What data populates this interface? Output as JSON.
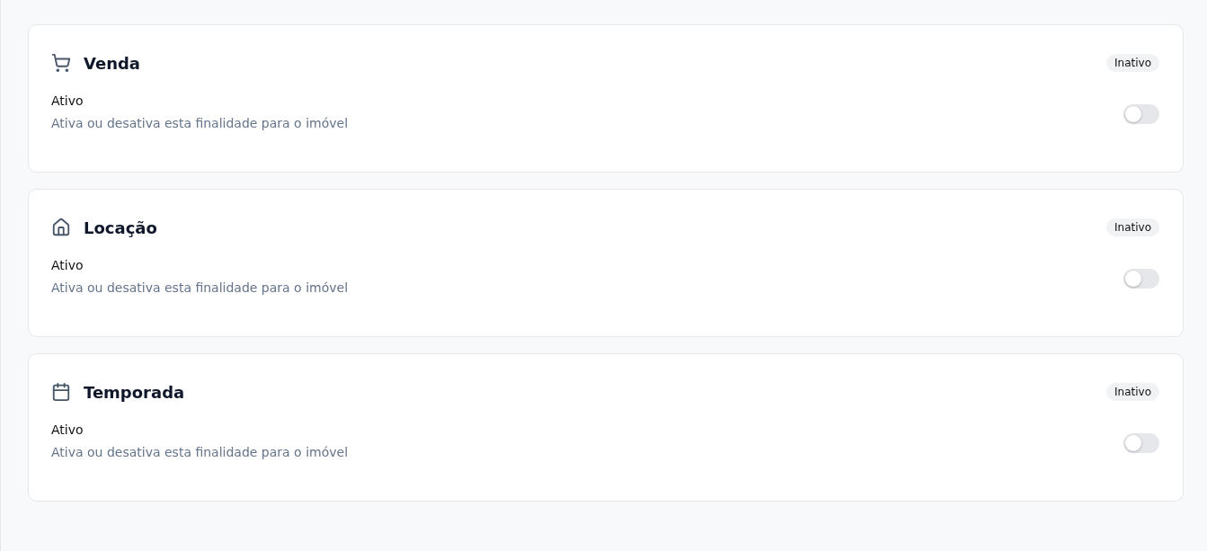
{
  "cards": [
    {
      "kind": "cart",
      "title": "Venda",
      "badge": "Inativo",
      "setting_label": "Ativo",
      "setting_description": "Ativa ou desativa esta finalidade para o imóvel",
      "on": false
    },
    {
      "kind": "house",
      "title": "Locação",
      "badge": "Inativo",
      "setting_label": "Ativo",
      "setting_description": "Ativa ou desativa esta finalidade para o imóvel",
      "on": false
    },
    {
      "kind": "calendar",
      "title": "Temporada",
      "badge": "Inativo",
      "setting_label": "Ativo",
      "setting_description": "Ativa ou desativa esta finalidade para o imóvel",
      "on": false
    }
  ]
}
